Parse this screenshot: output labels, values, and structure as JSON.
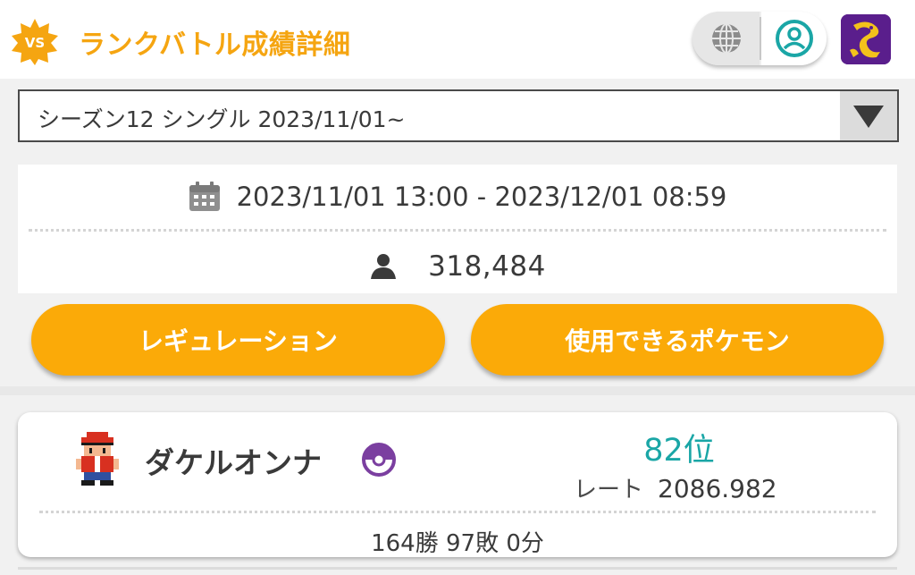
{
  "header": {
    "badge_text": "VS",
    "title": "ランクバトル成績詳細",
    "badge_icon": "vs-star-badge-icon",
    "language_icon": "globe-icon",
    "account_icon": "user-circle-icon",
    "emblem_icon": "dragon-emblem-icon",
    "colors": {
      "title": "#f5a511",
      "account_ring": "#1aa6a6",
      "emblem_bg": "#5a1e8c"
    }
  },
  "season_select": {
    "selected": "シーズン12 シングル 2023/11/01~",
    "arrow_icon": "triangle-down-icon"
  },
  "season_info": {
    "period": "2023/11/01 13:00 - 2023/12/01 08:59",
    "calendar_icon": "calendar-icon",
    "participants": "318,484",
    "person_icon": "person-icon"
  },
  "buttons": {
    "regulation": "レギュレーション",
    "usable_pokemon": "使用できるポケモン",
    "color": "#fbaa08"
  },
  "player": {
    "name": "ダケルオンナ",
    "rank": "82位",
    "rate_label": "レート",
    "rate_value": "2086.982",
    "record": "164勝 97敗 0分",
    "sprite_icon": "trainer-sprite-icon",
    "ball_icon": "master-ball-icon",
    "rank_color": "#1aa6a6"
  }
}
